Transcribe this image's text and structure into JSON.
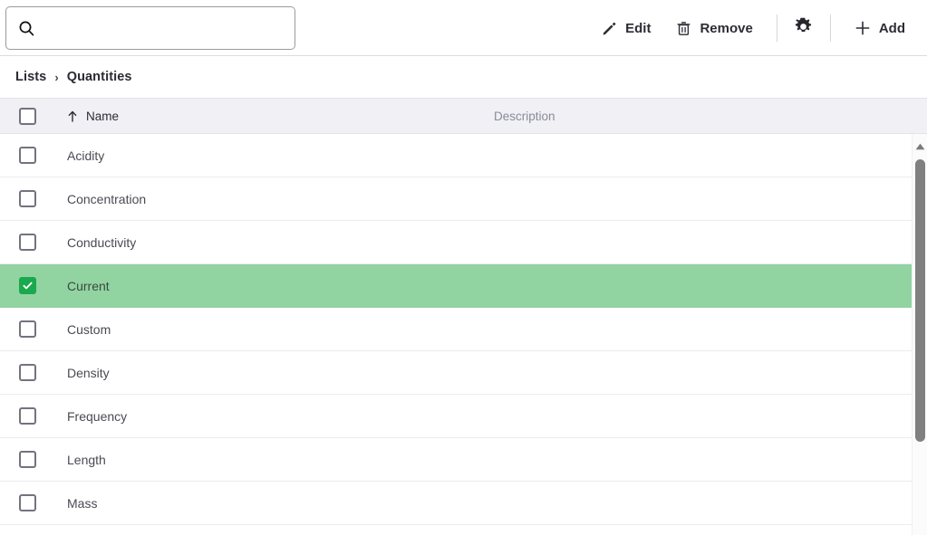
{
  "toolbar": {
    "search": {
      "value": "",
      "placeholder": "",
      "icon": "search-icon"
    },
    "edit_label": "Edit",
    "remove_label": "Remove",
    "add_label": "Add",
    "settings_icon": "gear-icon",
    "edit_icon": "pencil-icon",
    "remove_icon": "trash-icon",
    "add_icon": "plus-icon"
  },
  "breadcrumb": {
    "items": [
      {
        "label": "Lists"
      },
      {
        "label": "Quantities"
      }
    ],
    "separator": "›"
  },
  "table": {
    "columns": {
      "name": "Name",
      "description": "Description"
    },
    "sort": {
      "column": "Name",
      "direction": "ascending",
      "icon": "arrow-up-icon"
    },
    "header_checkbox_checked": false,
    "rows": [
      {
        "name": "Acidity",
        "description": "",
        "selected": false,
        "checked": false
      },
      {
        "name": "Concentration",
        "description": "",
        "selected": false,
        "checked": false
      },
      {
        "name": "Conductivity",
        "description": "",
        "selected": false,
        "checked": false
      },
      {
        "name": "Current",
        "description": "",
        "selected": true,
        "checked": true
      },
      {
        "name": "Custom",
        "description": "",
        "selected": false,
        "checked": false
      },
      {
        "name": "Density",
        "description": "",
        "selected": false,
        "checked": false
      },
      {
        "name": "Frequency",
        "description": "",
        "selected": false,
        "checked": false
      },
      {
        "name": "Length",
        "description": "",
        "selected": false,
        "checked": false
      },
      {
        "name": "Mass",
        "description": "",
        "selected": false,
        "checked": false
      }
    ]
  },
  "scrollbar": {
    "up_arrow_icon": "triangle-up-icon",
    "thumb_position_percent": 0,
    "thumb_size_percent": 72
  },
  "colors": {
    "selection_row": "#92d3a2",
    "checkbox_checked": "#1aa94c",
    "header_band": "#f0f0f5",
    "text_primary": "#2b2b33",
    "text_muted": "#8b8b9b"
  }
}
